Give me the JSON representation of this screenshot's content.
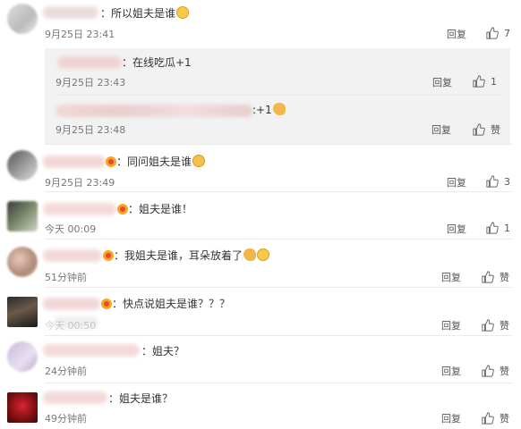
{
  "comments": [
    {
      "text": "：所以姐夫是谁",
      "time": "9月25日 23:41",
      "reply": "回复",
      "likes": "7"
    },
    {
      "text": "：同问姐夫是谁",
      "time": "9月25日 23:49",
      "reply": "回复",
      "likes": "3"
    },
    {
      "text": "：姐夫是谁！",
      "time": "今天 00:09",
      "reply": "回复",
      "likes": "1"
    },
    {
      "text": "：我姐夫是谁，耳朵放着了",
      "time": "51分钟前",
      "reply": "回复",
      "likes": "赞"
    },
    {
      "text": "：快点说姐夫是谁？？？",
      "time": "今天 00:50",
      "reply": "回复",
      "likes": "赞"
    },
    {
      "text": "：姐夫？",
      "time": "24分钟前",
      "reply": "回复",
      "likes": "赞"
    },
    {
      "text": "：姐夫是谁？",
      "time": "49分钟前",
      "reply": "回复",
      "likes": "赞"
    }
  ],
  "subcomments": [
    {
      "text": "：在线吃瓜+1",
      "time": "9月25日 23:43",
      "reply": "回复",
      "likes": "1"
    },
    {
      "text": ":+1",
      "time": "9月25日 23:48",
      "reply": "回复",
      "likes": "赞"
    }
  ],
  "icons": {
    "like": "thumbs-up-icon",
    "emoji_laugh": "laughing-face-icon",
    "emoji_ear": "ear-icon",
    "emoji_pray": "peace-hand-icon"
  },
  "colors": {
    "background": "#ffffff",
    "sub_background": "#f2f2f2",
    "separator": "#eaeaea",
    "muted": "#777777"
  }
}
